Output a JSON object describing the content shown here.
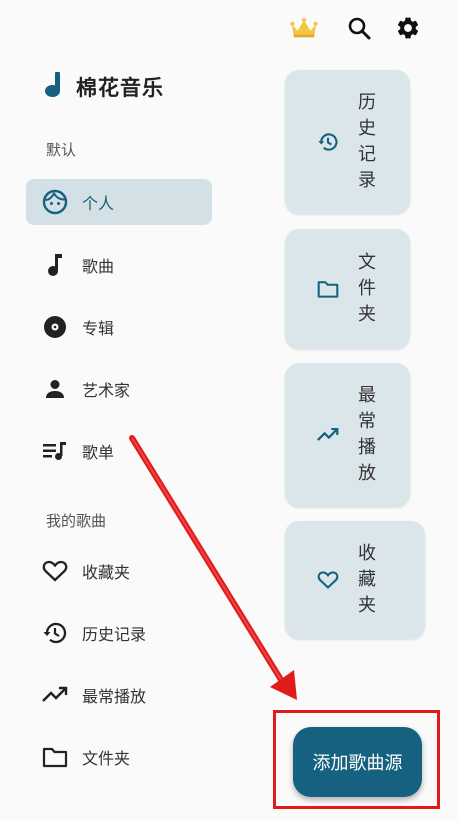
{
  "app": {
    "title": "棉花音乐"
  },
  "topbar": {
    "crown_icon": "crown-icon",
    "search_icon": "search-icon",
    "settings_icon": "gear-icon"
  },
  "sidebar": {
    "default_section": "默认",
    "default_items": [
      {
        "label": "个人",
        "icon": "face-icon",
        "active": true
      },
      {
        "label": "歌曲",
        "icon": "music-note-icon"
      },
      {
        "label": "专辑",
        "icon": "album-icon"
      },
      {
        "label": "艺术家",
        "icon": "person-icon"
      },
      {
        "label": "歌单",
        "icon": "playlist-icon"
      }
    ],
    "my_section": "我的歌曲",
    "my_items": [
      {
        "label": "收藏夹",
        "icon": "heart-icon"
      },
      {
        "label": "历史记录",
        "icon": "history-icon"
      },
      {
        "label": "最常播放",
        "icon": "trending-icon"
      },
      {
        "label": "文件夹",
        "icon": "folder-icon"
      }
    ]
  },
  "cards": [
    {
      "label": "历史记录",
      "icon": "history-icon"
    },
    {
      "label": "文件夹",
      "icon": "folder-icon"
    },
    {
      "label": "最常播放",
      "icon": "trending-icon"
    },
    {
      "label": "收藏夹",
      "icon": "heart-icon"
    }
  ],
  "fab": {
    "label": "添加歌曲源"
  },
  "colors": {
    "accent": "#15617f",
    "active_bg": "#d3e1e7",
    "card_bg": "#dbe6ea",
    "annotation": "#e01b1b"
  }
}
